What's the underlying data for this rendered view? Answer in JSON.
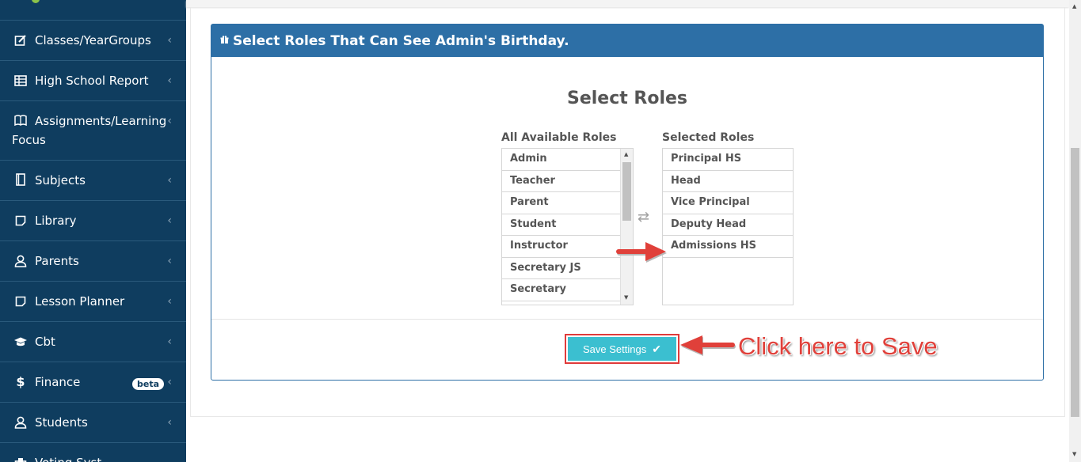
{
  "sidebar": {
    "items": [
      {
        "label": "Classes/YearGroups",
        "icon": "edit-icon"
      },
      {
        "label": "High School Report",
        "icon": "table-icon"
      },
      {
        "label": "Assignments/Learning Focus",
        "icon": "book-icon"
      },
      {
        "label": "Subjects",
        "icon": "notebook-icon"
      },
      {
        "label": "Library",
        "icon": "square-icon"
      },
      {
        "label": "Parents",
        "icon": "user-icon"
      },
      {
        "label": "Lesson Planner",
        "icon": "note-icon"
      },
      {
        "label": "Cbt",
        "icon": "graduation-cap-icon"
      },
      {
        "label": "Finance",
        "icon": "dollar-icon",
        "badge": "beta"
      },
      {
        "label": "Students",
        "icon": "user-icon"
      },
      {
        "label": "Voting Syst...",
        "icon": "vote-icon"
      }
    ],
    "chevron": "‹"
  },
  "panel": {
    "title": "Select Roles That Can See Admin's Birthday.",
    "title_icon": "gift-icon",
    "heading": "Select Roles"
  },
  "available": {
    "label": "All Available Roles",
    "options": [
      "Admin",
      "Teacher",
      "Parent",
      "Student",
      "Instructor",
      "Secretary JS",
      "Secretary"
    ]
  },
  "selected": {
    "label": "Selected Roles",
    "options": [
      "Principal HS",
      "Head",
      "Vice Principal",
      "Deputy Head",
      "Admissions HS"
    ]
  },
  "actions": {
    "save_label": "Save Settings",
    "swap_icon": "⇄"
  },
  "annotation": {
    "text": "Click here to Save",
    "color": "#e0403a"
  },
  "colors": {
    "sidebar": "#0f3d5f",
    "panel_header": "#2d6fa6",
    "save_button": "#3bbfd0",
    "annotation": "#e0403a"
  }
}
